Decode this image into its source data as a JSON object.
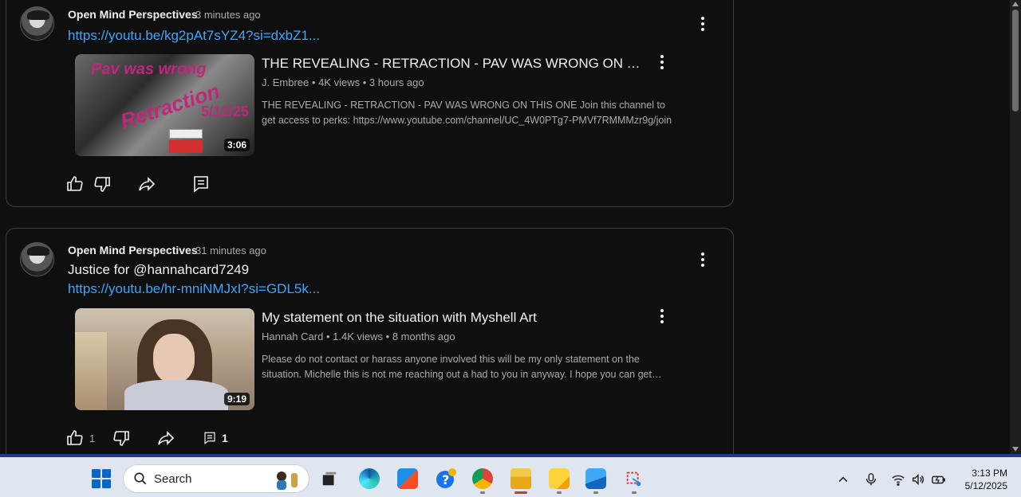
{
  "posts": [
    {
      "author": "Open Mind Perspectives",
      "time": "3 minutes ago",
      "text": "",
      "link": "https://youtu.be/kg2pAt7sYZ4?si=dxbZ1...",
      "video": {
        "title": "THE REVEALING - RETRACTION - PAV WAS WRONG ON THIS ONE",
        "channel": "J. Embree",
        "views": "4K views",
        "age": "3 hours ago",
        "description": "THE REVEALING - RETRACTION - PAV WAS WRONG ON THIS ONE Join this channel to get access to perks: https://www.youtube.com/channel/UC_4W0PTg7-PMVf7RMMMzr9g/join",
        "duration": "3:06",
        "thumb_text": [
          "Pav was wrong",
          "Retraction",
          "5/12/25"
        ]
      },
      "likes": "",
      "comments": ""
    },
    {
      "author": "Open Mind Perspectives",
      "time": "31 minutes ago",
      "text": "Justice for @hannahcard7249",
      "link": "https://youtu.be/hr-mniNMJxI?si=GDL5k...",
      "video": {
        "title": "My statement on the situation with Myshell Art",
        "channel": "Hannah Card",
        "views": "1.4K views",
        "age": "8 months ago",
        "description": "Please do not contact or harass anyone involved this will be my only statement on the situation. Michelle this is not me reaching out a had to you in anyway. I hope you can get…",
        "duration": "9:19"
      },
      "likes": "1",
      "comments": "1"
    }
  ],
  "meta_separator": "•",
  "taskbar": {
    "search_placeholder": "Search",
    "clock_time": "3:13 PM",
    "clock_date": "5/12/2025"
  },
  "colors": {
    "background": "#0f0f0f",
    "link": "#3ea6ff",
    "taskbar": "#dfe6ef",
    "accent": "#1e3a8a"
  }
}
